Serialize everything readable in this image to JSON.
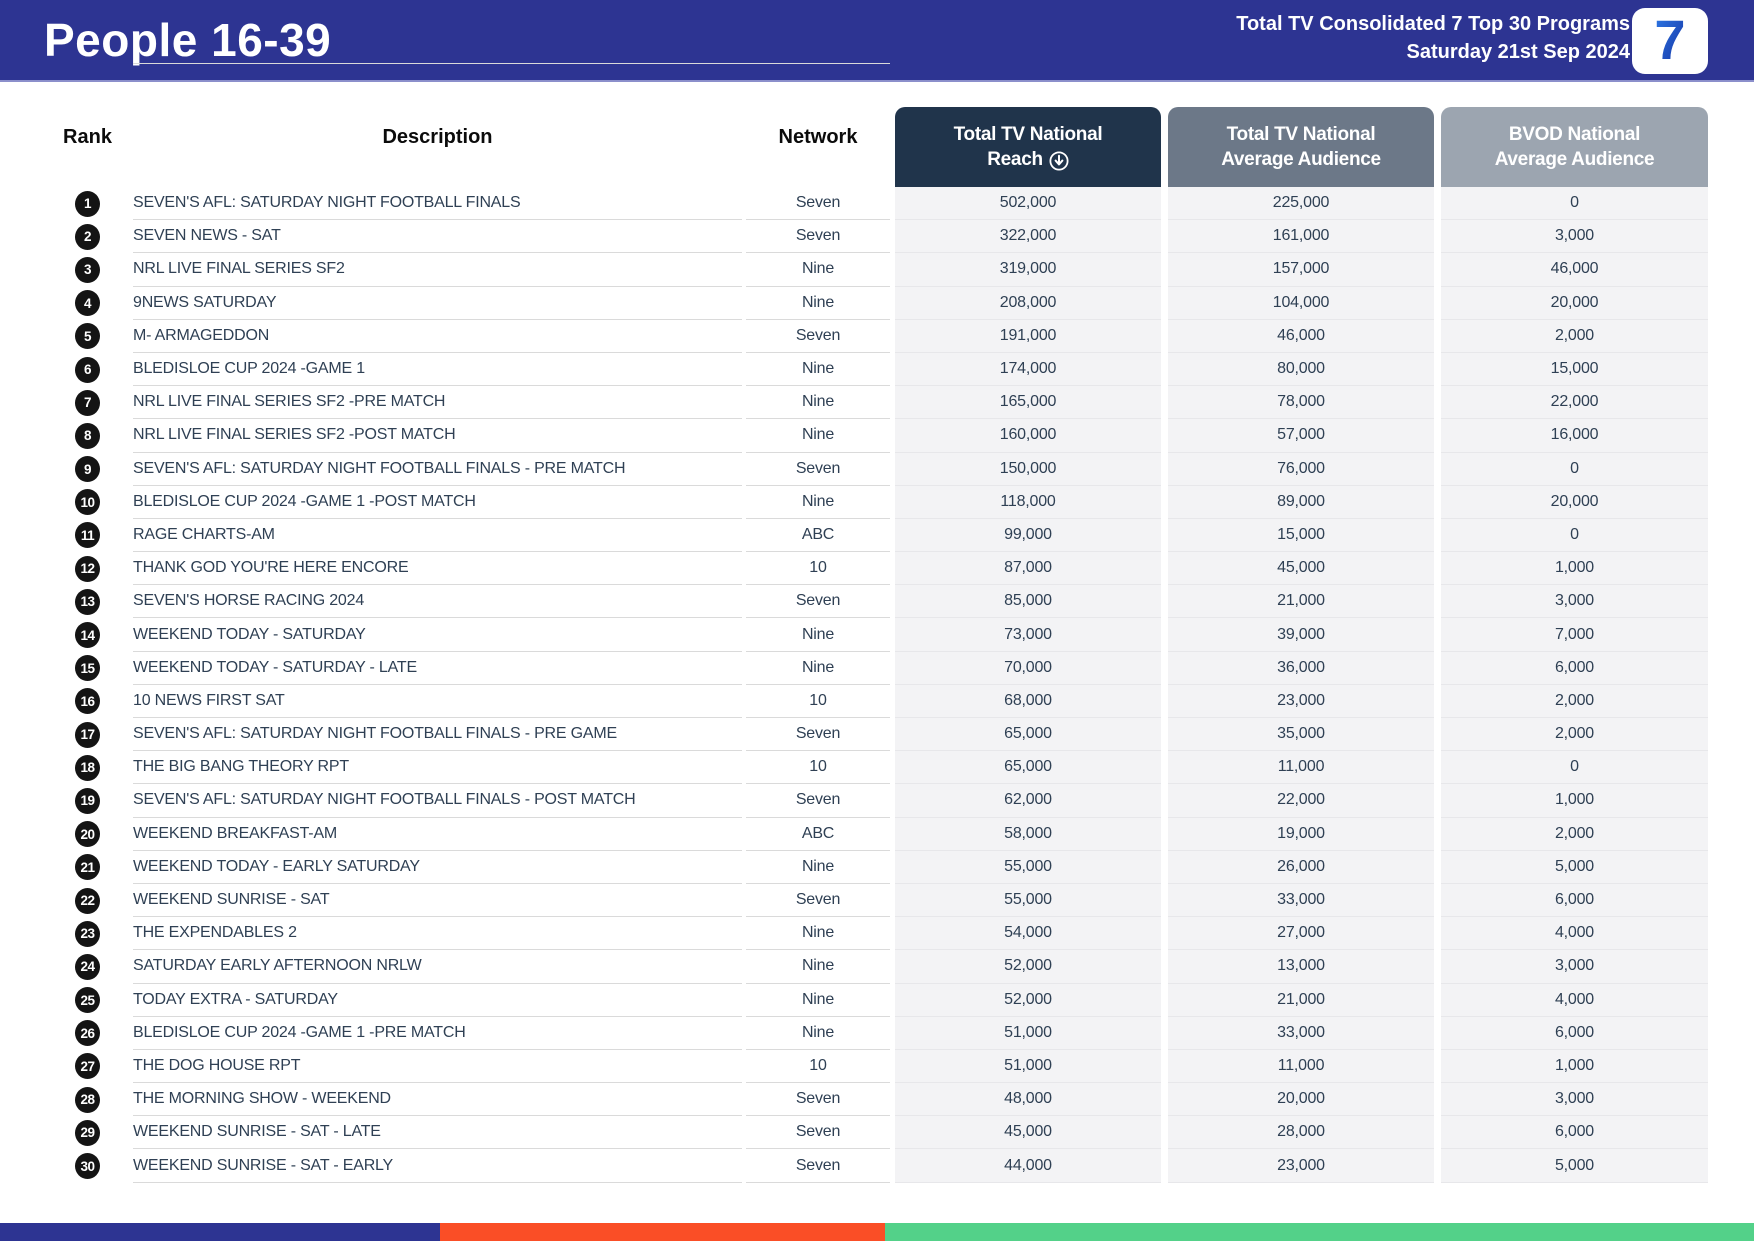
{
  "header": {
    "title": "People 16-39",
    "subtitle_line1": "Total TV Consolidated 7 Top 30 Programs",
    "subtitle_line2": "Saturday 21st Sep 2024",
    "logo_text": "7",
    "band_color": "#2D3492"
  },
  "table": {
    "column_labels": {
      "rank": "Rank",
      "description": "Description",
      "network": "Network"
    },
    "metric_headers": [
      {
        "line1": "Total TV National",
        "line2": "Reach",
        "sort_icon": "circle-arrow-down",
        "color": "#20344B"
      },
      {
        "line1": "Total TV National",
        "line2": "Average Audience",
        "color": "#6C7888"
      },
      {
        "line1": "BVOD National",
        "line2": "Average Audience",
        "color": "#9CA5B0"
      }
    ],
    "rows": [
      {
        "rank": "1",
        "description": "SEVEN'S AFL: SATURDAY NIGHT FOOTBALL FINALS",
        "network": "Seven",
        "reach": "502,000",
        "avg_audience": "225,000",
        "bvod_audience": "0"
      },
      {
        "rank": "2",
        "description": "SEVEN NEWS - SAT",
        "network": "Seven",
        "reach": "322,000",
        "avg_audience": "161,000",
        "bvod_audience": "3,000"
      },
      {
        "rank": "3",
        "description": "NRL LIVE FINAL SERIES SF2",
        "network": "Nine",
        "reach": "319,000",
        "avg_audience": "157,000",
        "bvod_audience": "46,000"
      },
      {
        "rank": "4",
        "description": "9NEWS SATURDAY",
        "network": "Nine",
        "reach": "208,000",
        "avg_audience": "104,000",
        "bvod_audience": "20,000"
      },
      {
        "rank": "5",
        "description": "M- ARMAGEDDON",
        "network": "Seven",
        "reach": "191,000",
        "avg_audience": "46,000",
        "bvod_audience": "2,000"
      },
      {
        "rank": "6",
        "description": "BLEDISLOE CUP 2024 -GAME 1",
        "network": "Nine",
        "reach": "174,000",
        "avg_audience": "80,000",
        "bvod_audience": "15,000"
      },
      {
        "rank": "7",
        "description": "NRL LIVE FINAL SERIES SF2 -PRE MATCH",
        "network": "Nine",
        "reach": "165,000",
        "avg_audience": "78,000",
        "bvod_audience": "22,000"
      },
      {
        "rank": "8",
        "description": "NRL LIVE FINAL SERIES SF2 -POST MATCH",
        "network": "Nine",
        "reach": "160,000",
        "avg_audience": "57,000",
        "bvod_audience": "16,000"
      },
      {
        "rank": "9",
        "description": "SEVEN'S AFL: SATURDAY NIGHT FOOTBALL FINALS - PRE MATCH",
        "network": "Seven",
        "reach": "150,000",
        "avg_audience": "76,000",
        "bvod_audience": "0"
      },
      {
        "rank": "10",
        "description": "BLEDISLOE CUP 2024 -GAME 1 -POST MATCH",
        "network": "Nine",
        "reach": "118,000",
        "avg_audience": "89,000",
        "bvod_audience": "20,000"
      },
      {
        "rank": "11",
        "description": "RAGE CHARTS-AM",
        "network": "ABC",
        "reach": "99,000",
        "avg_audience": "15,000",
        "bvod_audience": "0"
      },
      {
        "rank": "12",
        "description": "THANK GOD YOU'RE HERE ENCORE",
        "network": "10",
        "reach": "87,000",
        "avg_audience": "45,000",
        "bvod_audience": "1,000"
      },
      {
        "rank": "13",
        "description": "SEVEN'S HORSE RACING 2024",
        "network": "Seven",
        "reach": "85,000",
        "avg_audience": "21,000",
        "bvod_audience": "3,000"
      },
      {
        "rank": "14",
        "description": "WEEKEND TODAY - SATURDAY",
        "network": "Nine",
        "reach": "73,000",
        "avg_audience": "39,000",
        "bvod_audience": "7,000"
      },
      {
        "rank": "15",
        "description": "WEEKEND TODAY - SATURDAY - LATE",
        "network": "Nine",
        "reach": "70,000",
        "avg_audience": "36,000",
        "bvod_audience": "6,000"
      },
      {
        "rank": "16",
        "description": "10 NEWS FIRST SAT",
        "network": "10",
        "reach": "68,000",
        "avg_audience": "23,000",
        "bvod_audience": "2,000"
      },
      {
        "rank": "17",
        "description": "SEVEN'S AFL: SATURDAY NIGHT FOOTBALL FINALS - PRE GAME",
        "network": "Seven",
        "reach": "65,000",
        "avg_audience": "35,000",
        "bvod_audience": "2,000"
      },
      {
        "rank": "18",
        "description": "THE BIG BANG THEORY RPT",
        "network": "10",
        "reach": "65,000",
        "avg_audience": "11,000",
        "bvod_audience": "0"
      },
      {
        "rank": "19",
        "description": "SEVEN'S AFL: SATURDAY NIGHT FOOTBALL FINALS - POST MATCH",
        "network": "Seven",
        "reach": "62,000",
        "avg_audience": "22,000",
        "bvod_audience": "1,000"
      },
      {
        "rank": "20",
        "description": "WEEKEND BREAKFAST-AM",
        "network": "ABC",
        "reach": "58,000",
        "avg_audience": "19,000",
        "bvod_audience": "2,000"
      },
      {
        "rank": "21",
        "description": "WEEKEND TODAY - EARLY SATURDAY",
        "network": "Nine",
        "reach": "55,000",
        "avg_audience": "26,000",
        "bvod_audience": "5,000"
      },
      {
        "rank": "22",
        "description": "WEEKEND SUNRISE - SAT",
        "network": "Seven",
        "reach": "55,000",
        "avg_audience": "33,000",
        "bvod_audience": "6,000"
      },
      {
        "rank": "23",
        "description": "THE EXPENDABLES 2",
        "network": "Nine",
        "reach": "54,000",
        "avg_audience": "27,000",
        "bvod_audience": "4,000"
      },
      {
        "rank": "24",
        "description": "SATURDAY EARLY AFTERNOON NRLW",
        "network": "Nine",
        "reach": "52,000",
        "avg_audience": "13,000",
        "bvod_audience": "3,000"
      },
      {
        "rank": "25",
        "description": "TODAY EXTRA - SATURDAY",
        "network": "Nine",
        "reach": "52,000",
        "avg_audience": "21,000",
        "bvod_audience": "4,000"
      },
      {
        "rank": "26",
        "description": "BLEDISLOE CUP 2024 -GAME 1 -PRE MATCH",
        "network": "Nine",
        "reach": "51,000",
        "avg_audience": "33,000",
        "bvod_audience": "6,000"
      },
      {
        "rank": "27",
        "description": "THE DOG HOUSE RPT",
        "network": "10",
        "reach": "51,000",
        "avg_audience": "11,000",
        "bvod_audience": "1,000"
      },
      {
        "rank": "28",
        "description": "THE MORNING SHOW - WEEKEND",
        "network": "Seven",
        "reach": "48,000",
        "avg_audience": "20,000",
        "bvod_audience": "3,000"
      },
      {
        "rank": "29",
        "description": "WEEKEND SUNRISE - SAT - LATE",
        "network": "Seven",
        "reach": "45,000",
        "avg_audience": "28,000",
        "bvod_audience": "6,000"
      },
      {
        "rank": "30",
        "description": "WEEKEND SUNRISE - SAT - EARLY",
        "network": "Seven",
        "reach": "44,000",
        "avg_audience": "23,000",
        "bvod_audience": "5,000"
      }
    ]
  },
  "footer": {
    "stripe_colors": [
      "#2D3492",
      "#FA4E26",
      "#53D189"
    ]
  }
}
